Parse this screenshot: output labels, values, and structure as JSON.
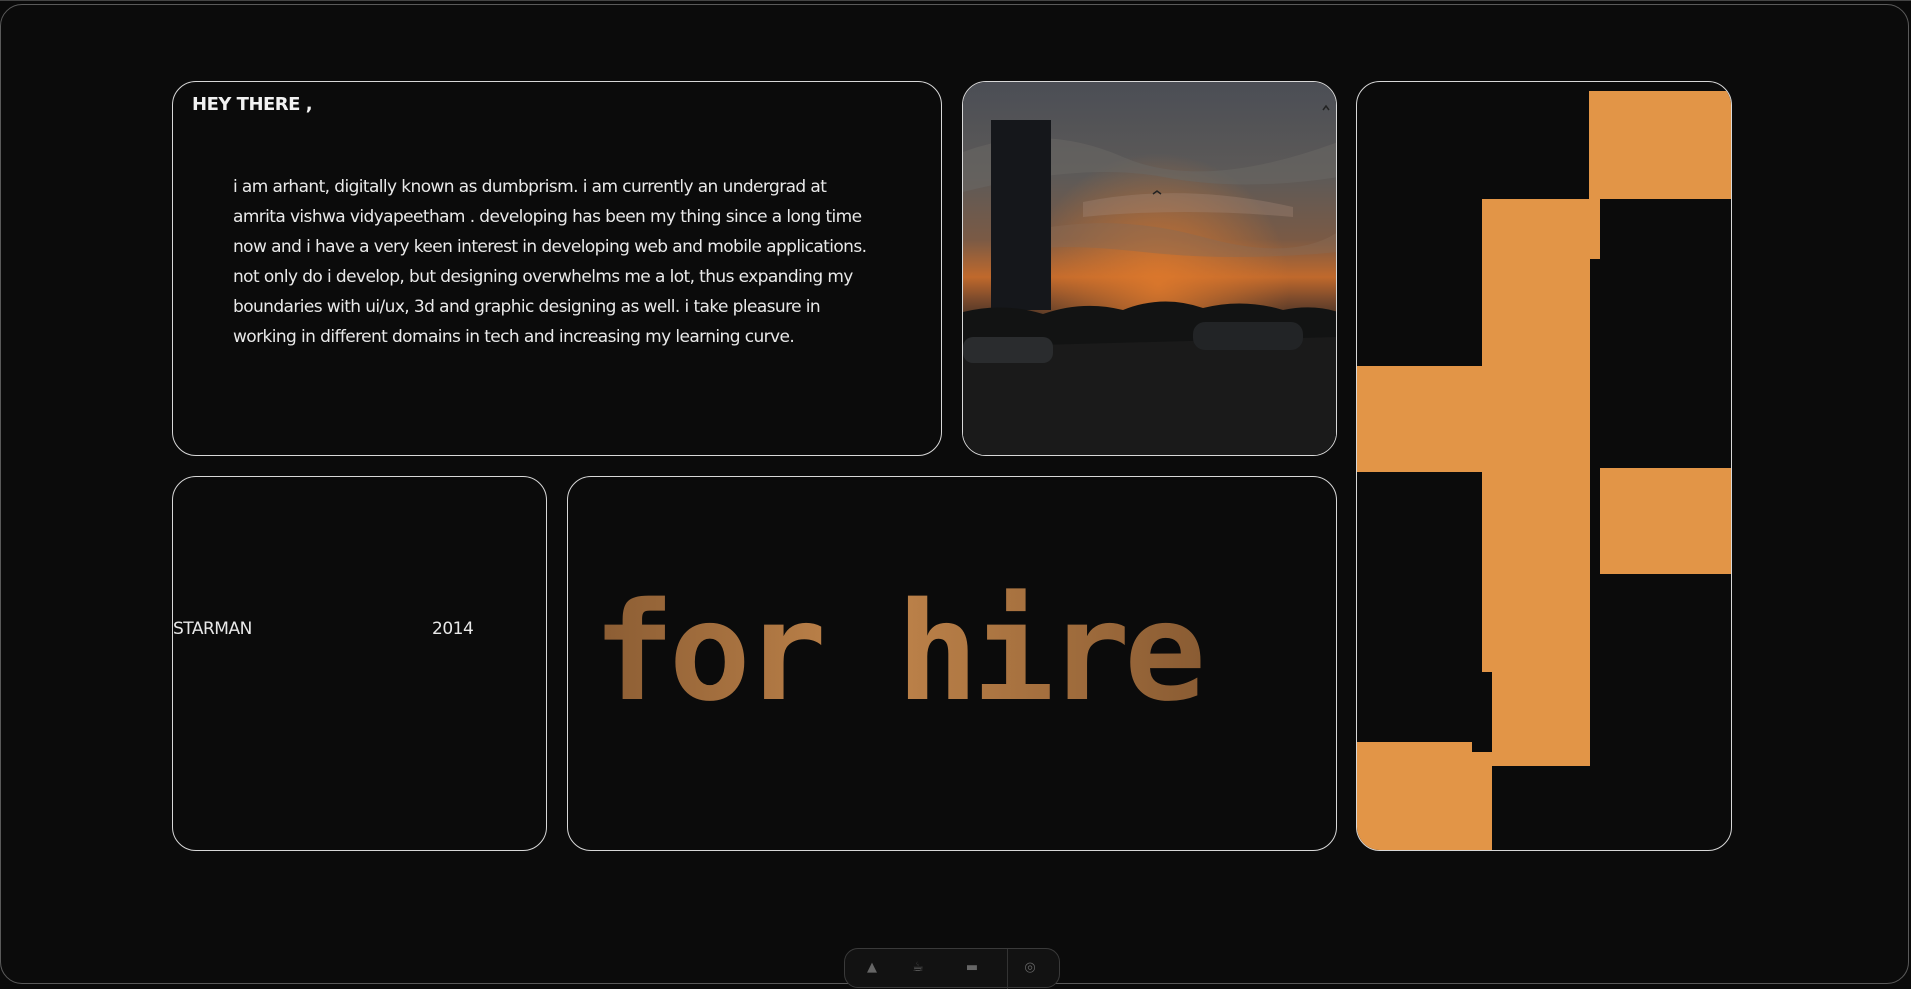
{
  "about": {
    "greeting": "HEY THERE ,",
    "bio": "i am arhant, digitally known as dumbprism. i am currently an undergrad at amrita vishwa vidyapeetham . developing has been my thing since a long time now and i have a very keen interest in developing web and mobile applications. not only do i develop, but designing overwhelms me a lot, thus expanding my boundaries with ui/ux, 3d and graphic designing as well. i take pleasure in working in different domains in tech and increasing my learning curve."
  },
  "photo": {
    "subject": "sunset sky over billboard and road"
  },
  "music": {
    "title": "STARMAN",
    "year": "2014"
  },
  "hire": {
    "label": "for hire"
  },
  "pixel_art": {
    "color": "#e29547",
    "icon": "pixel-glyph-icon"
  },
  "dock": {
    "icons": [
      "bell-icon",
      "coffee-icon",
      "menu-icon",
      "github-icon"
    ]
  },
  "colors": {
    "background": "#0b0b0b",
    "border": "#d8d8d8",
    "accent": "#e29547",
    "text": "#ececec"
  }
}
